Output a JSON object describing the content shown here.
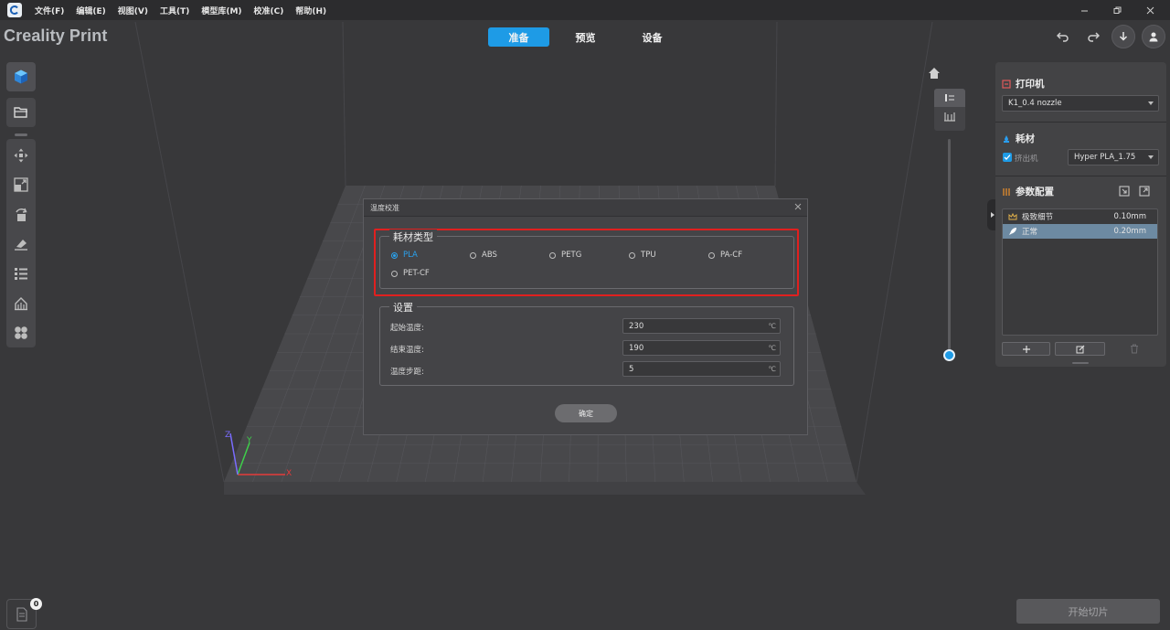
{
  "menu": {
    "items": [
      "文件(F)",
      "编辑(E)",
      "视图(V)",
      "工具(T)",
      "模型库(M)",
      "校准(C)",
      "帮助(H)"
    ]
  },
  "brand": "Creality Print",
  "tabs": [
    {
      "label": "准备",
      "active": true
    },
    {
      "label": "预览",
      "active": false
    },
    {
      "label": "设备",
      "active": false
    }
  ],
  "left_toolbar": {
    "top_tools": [
      "cube-icon",
      "folder-icon"
    ],
    "tools": [
      "move-icon",
      "scale-icon",
      "rotate-icon",
      "lay-flat-icon",
      "layout-icon",
      "support-icon",
      "split-icon"
    ]
  },
  "layer_panel": {
    "selected_view": "single-layer-icon",
    "other_view": "all-layers-icon"
  },
  "right_panel": {
    "printer": {
      "title": "打印机",
      "selected": "K1_0.4 nozzle"
    },
    "filament": {
      "title": "耗材",
      "extruder_label": "挤出机",
      "extruder_checked": true,
      "selected": "Hyper PLA_1.75"
    },
    "profile": {
      "title": "参数配置",
      "items": [
        {
          "name": "极致细节",
          "value": "0.10mm",
          "selected": false,
          "icon": "crown-icon"
        },
        {
          "name": "正常",
          "value": "0.20mm",
          "selected": true,
          "icon": "rocket-icon"
        }
      ]
    }
  },
  "dialog": {
    "title": "温度校准",
    "material_group": {
      "legend": "耗材类型",
      "options": [
        "PLA",
        "ABS",
        "PETG",
        "TPU",
        "PA-CF",
        "PET-CF"
      ],
      "selected": "PLA"
    },
    "settings_group": {
      "legend": "设置",
      "rows": [
        {
          "label": "起始温度:",
          "value": "230",
          "unit": "℃"
        },
        {
          "label": "结束温度:",
          "value": "190",
          "unit": "℃"
        },
        {
          "label": "温度步距:",
          "value": "5",
          "unit": "℃"
        }
      ]
    },
    "ok_label": "确定"
  },
  "axes": {
    "x": "X",
    "y": "Y",
    "z": "Z"
  },
  "notifications": {
    "count": "0"
  },
  "slice_button": "开始切片",
  "colors": {
    "accent": "#1e9be6",
    "highlight_box": "#e0201f",
    "x_axis": "#e53a3a",
    "y_axis": "#3ecf4a",
    "z_axis": "#7a6cff"
  }
}
